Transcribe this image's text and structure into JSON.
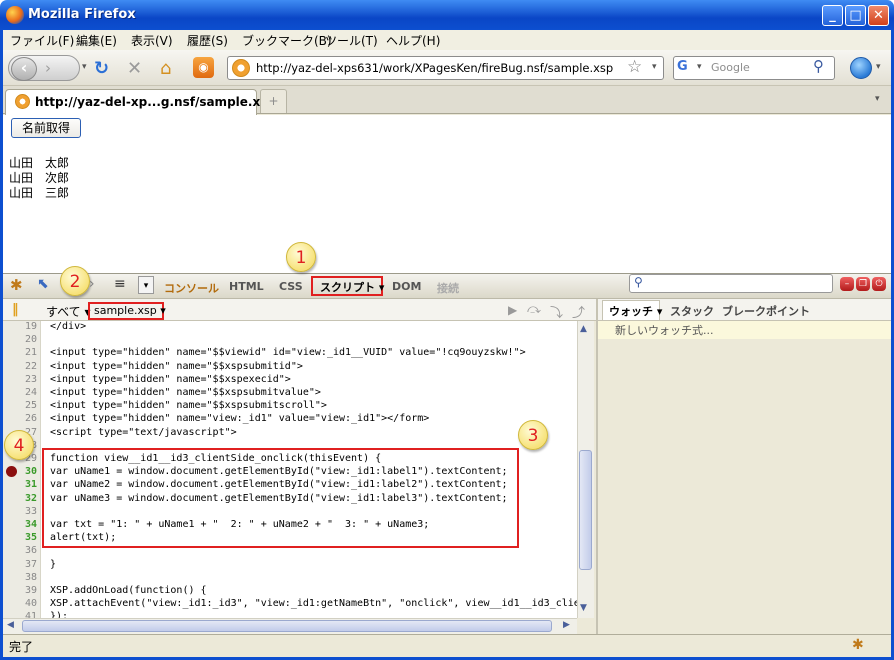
{
  "window": {
    "title": "Mozilla Firefox",
    "minimize": "_",
    "maximize": "□",
    "close": "✕"
  },
  "menu": [
    "ファイル(F)",
    "編集(E)",
    "表示(V)",
    "履歴(S)",
    "ブックマーク(B)",
    "ツール(T)",
    "ヘルプ(H)"
  ],
  "navbar": {
    "url": "http://yaz-del-xps631/work/XPagesKen/fireBug.nsf/sample.xsp",
    "search_placeholder": "Google"
  },
  "tab": {
    "title": "http://yaz-del-xp...g.nsf/sample.xsp",
    "new_tab": "+"
  },
  "page": {
    "button_label": "名前取得",
    "names": [
      "山田　太郎",
      "山田　次郎",
      "山田　三郎"
    ]
  },
  "firebug": {
    "tabs": {
      "console": "コンソール",
      "html": "HTML",
      "css": "CSS",
      "script": "スクリプト ▾",
      "dom": "DOM",
      "net": "接続"
    },
    "filter_all": "すべて ▾",
    "file_selector": "sample.xsp ▾",
    "side_tabs": {
      "watch": "ウォッチ ▾",
      "stack": "スタック",
      "breakpoints": "ブレークポイント"
    },
    "new_watch": "新しいウォッチ式...",
    "code": [
      {
        "n": "19",
        "t": "</div>"
      },
      {
        "n": "20",
        "t": ""
      },
      {
        "n": "21",
        "t": "<input type=\"hidden\" name=\"$$viewid\" id=\"view:_id1__VUID\" value=\"!cq9ouyzskw!\">"
      },
      {
        "n": "22",
        "t": "<input type=\"hidden\" name=\"$$xspsubmitid\">"
      },
      {
        "n": "23",
        "t": "<input type=\"hidden\" name=\"$$xspexecid\">"
      },
      {
        "n": "24",
        "t": "<input type=\"hidden\" name=\"$$xspsubmitvalue\">"
      },
      {
        "n": "25",
        "t": "<input type=\"hidden\" name=\"$$xspsubmitscroll\">"
      },
      {
        "n": "26",
        "t": "<input type=\"hidden\" name=\"view:_id1\" value=\"view:_id1\"></form>"
      },
      {
        "n": "27",
        "t": "<script type=\"text/javascript\">"
      },
      {
        "n": "28",
        "t": ""
      },
      {
        "n": "29",
        "t": "function view__id1__id3_clientSide_onclick(thisEvent) {"
      },
      {
        "n": "30",
        "t": "var uName1 = window.document.getElementById(\"view:_id1:label1\").textContent;"
      },
      {
        "n": "31",
        "t": "var uName2 = window.document.getElementById(\"view:_id1:label2\").textContent;"
      },
      {
        "n": "32",
        "t": "var uName3 = window.document.getElementById(\"view:_id1:label3\").textContent;"
      },
      {
        "n": "33",
        "t": ""
      },
      {
        "n": "34",
        "t": "var txt = \"1: \" + uName1 + \"  2: \" + uName2 + \"  3: \" + uName3;"
      },
      {
        "n": "35",
        "t": "alert(txt);"
      },
      {
        "n": "36",
        "t": ""
      },
      {
        "n": "37",
        "t": "}"
      },
      {
        "n": "38",
        "t": ""
      },
      {
        "n": "39",
        "t": "XSP.addOnLoad(function() {"
      },
      {
        "n": "40",
        "t": "XSP.attachEvent(\"view:_id1:_id3\", \"view:_id1:getNameBtn\", \"onclick\", view__id1__id3_clie"
      },
      {
        "n": "41",
        "t": "});"
      }
    ]
  },
  "status": "完了",
  "callouts": [
    "1",
    "2",
    "3",
    "4"
  ]
}
